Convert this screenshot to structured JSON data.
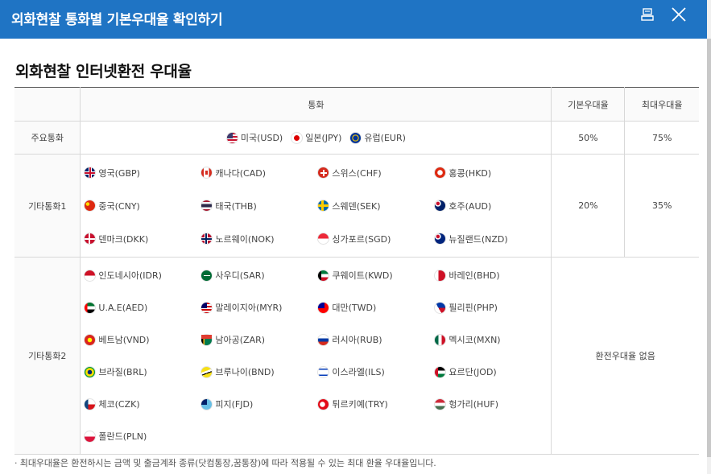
{
  "window": {
    "title": "외화현찰 통화별 기본우대율 확인하기"
  },
  "section": {
    "title": "외화현찰 인터넷환전 우대율"
  },
  "table": {
    "headers": {
      "group": "",
      "currency": "통화",
      "basic_rate": "기본우대율",
      "max_rate": "최대우대율"
    },
    "major": {
      "label": "주요통화",
      "items": [
        {
          "label": "미국(USD)",
          "flag": "us"
        },
        {
          "label": "일본(JPY)",
          "flag": "jp"
        },
        {
          "label": "유럽(EUR)",
          "flag": "eu"
        }
      ],
      "basic_rate": "50%",
      "max_rate": "75%"
    },
    "other1": {
      "label": "기타통화1",
      "items": [
        {
          "label": "영국(GBP)",
          "flag": "gb"
        },
        {
          "label": "캐나다(CAD)",
          "flag": "ca"
        },
        {
          "label": "스위스(CHF)",
          "flag": "ch"
        },
        {
          "label": "홍콩(HKD)",
          "flag": "hk"
        },
        {
          "label": "중국(CNY)",
          "flag": "cn"
        },
        {
          "label": "태국(THB)",
          "flag": "th"
        },
        {
          "label": "스웨덴(SEK)",
          "flag": "se"
        },
        {
          "label": "호주(AUD)",
          "flag": "au"
        },
        {
          "label": "덴마크(DKK)",
          "flag": "dk"
        },
        {
          "label": "노르웨이(NOK)",
          "flag": "no"
        },
        {
          "label": "싱가포르(SGD)",
          "flag": "sg"
        },
        {
          "label": "뉴질랜드(NZD)",
          "flag": "nz"
        }
      ],
      "basic_rate": "20%",
      "max_rate": "35%"
    },
    "other2": {
      "label": "기타통화2",
      "items": [
        {
          "label": "인도네시아(IDR)",
          "flag": "id"
        },
        {
          "label": "사우디(SAR)",
          "flag": "sa"
        },
        {
          "label": "쿠웨이트(KWD)",
          "flag": "kw"
        },
        {
          "label": "바레인(BHD)",
          "flag": "bh"
        },
        {
          "label": "U.A.E(AED)",
          "flag": "ae"
        },
        {
          "label": "말레이지아(MYR)",
          "flag": "my"
        },
        {
          "label": "대만(TWD)",
          "flag": "tw"
        },
        {
          "label": "필리핀(PHP)",
          "flag": "ph"
        },
        {
          "label": "베트남(VND)",
          "flag": "vn"
        },
        {
          "label": "남아공(ZAR)",
          "flag": "za"
        },
        {
          "label": "러시아(RUB)",
          "flag": "ru"
        },
        {
          "label": "멕시코(MXN)",
          "flag": "mx"
        },
        {
          "label": "브라질(BRL)",
          "flag": "br"
        },
        {
          "label": "브루나이(BND)",
          "flag": "bn"
        },
        {
          "label": "이스라엘(ILS)",
          "flag": "il"
        },
        {
          "label": "요르단(JOD)",
          "flag": "jo"
        },
        {
          "label": "체코(CZK)",
          "flag": "cz"
        },
        {
          "label": "피지(FJD)",
          "flag": "fj"
        },
        {
          "label": "튀르키예(TRY)",
          "flag": "tr"
        },
        {
          "label": "헝가리(HUF)",
          "flag": "hu"
        },
        {
          "label": "폴란드(PLN)",
          "flag": "pl"
        }
      ],
      "note": "환전우대율 없음"
    }
  },
  "footnote": "· 최대우대율은 환전하시는 금액 및 출금계좌 종류(닷컴통장,꿈통장)에 따라 적용될 수 있는 최대 환율 우대율입니다.",
  "icons": {
    "print": "print-icon",
    "close": "close-icon"
  },
  "colors": {
    "titlebar": "#1f74c4"
  }
}
